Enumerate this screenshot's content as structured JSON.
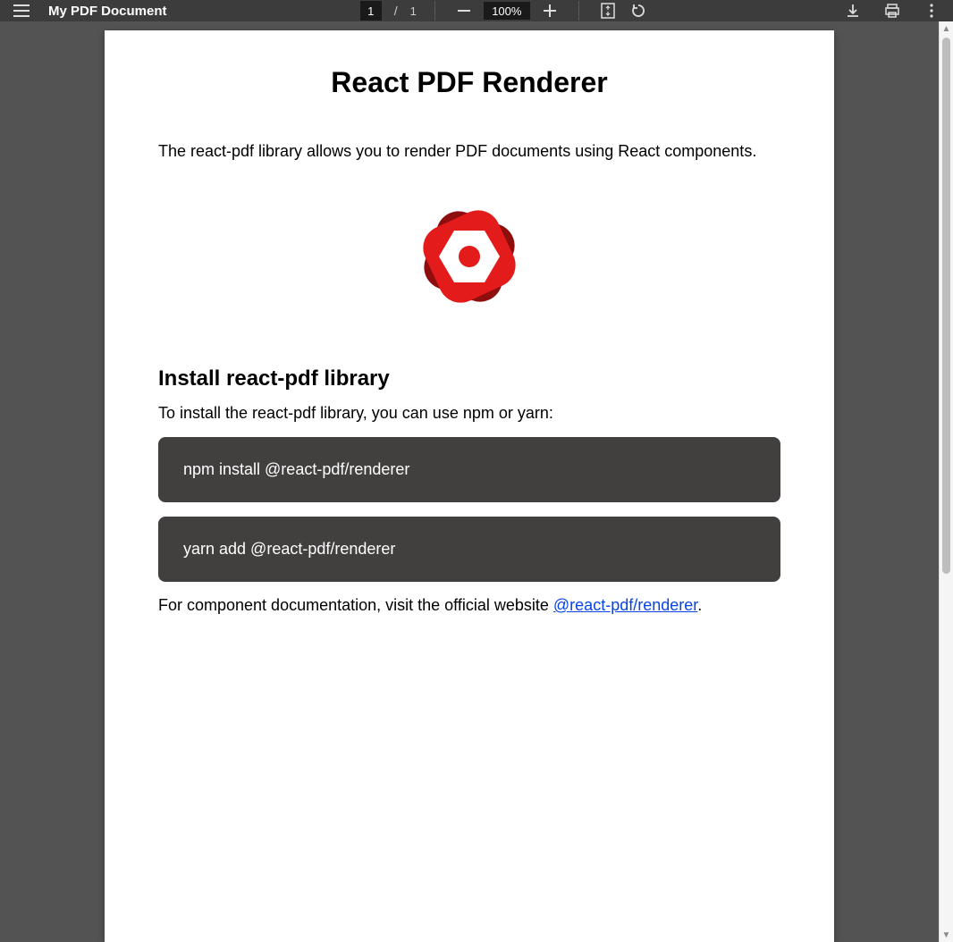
{
  "toolbar": {
    "doc_title": "My PDF Document",
    "page_current": "1",
    "page_separator": "/",
    "page_total": "1",
    "zoom_value": "100%"
  },
  "document": {
    "title": "React PDF Renderer",
    "intro": "The react-pdf library allows you to render PDF documents using React components.",
    "section_heading": "Install react-pdf library",
    "section_subtext": "To install the react-pdf library, you can use npm or yarn:",
    "code_npm": "npm install @react-pdf/renderer",
    "code_yarn": "yarn add @react-pdf/renderer",
    "footnote_prefix": "For component documentation, visit the official website ",
    "footnote_link_text": "@react-pdf/renderer",
    "footnote_suffix": "."
  }
}
